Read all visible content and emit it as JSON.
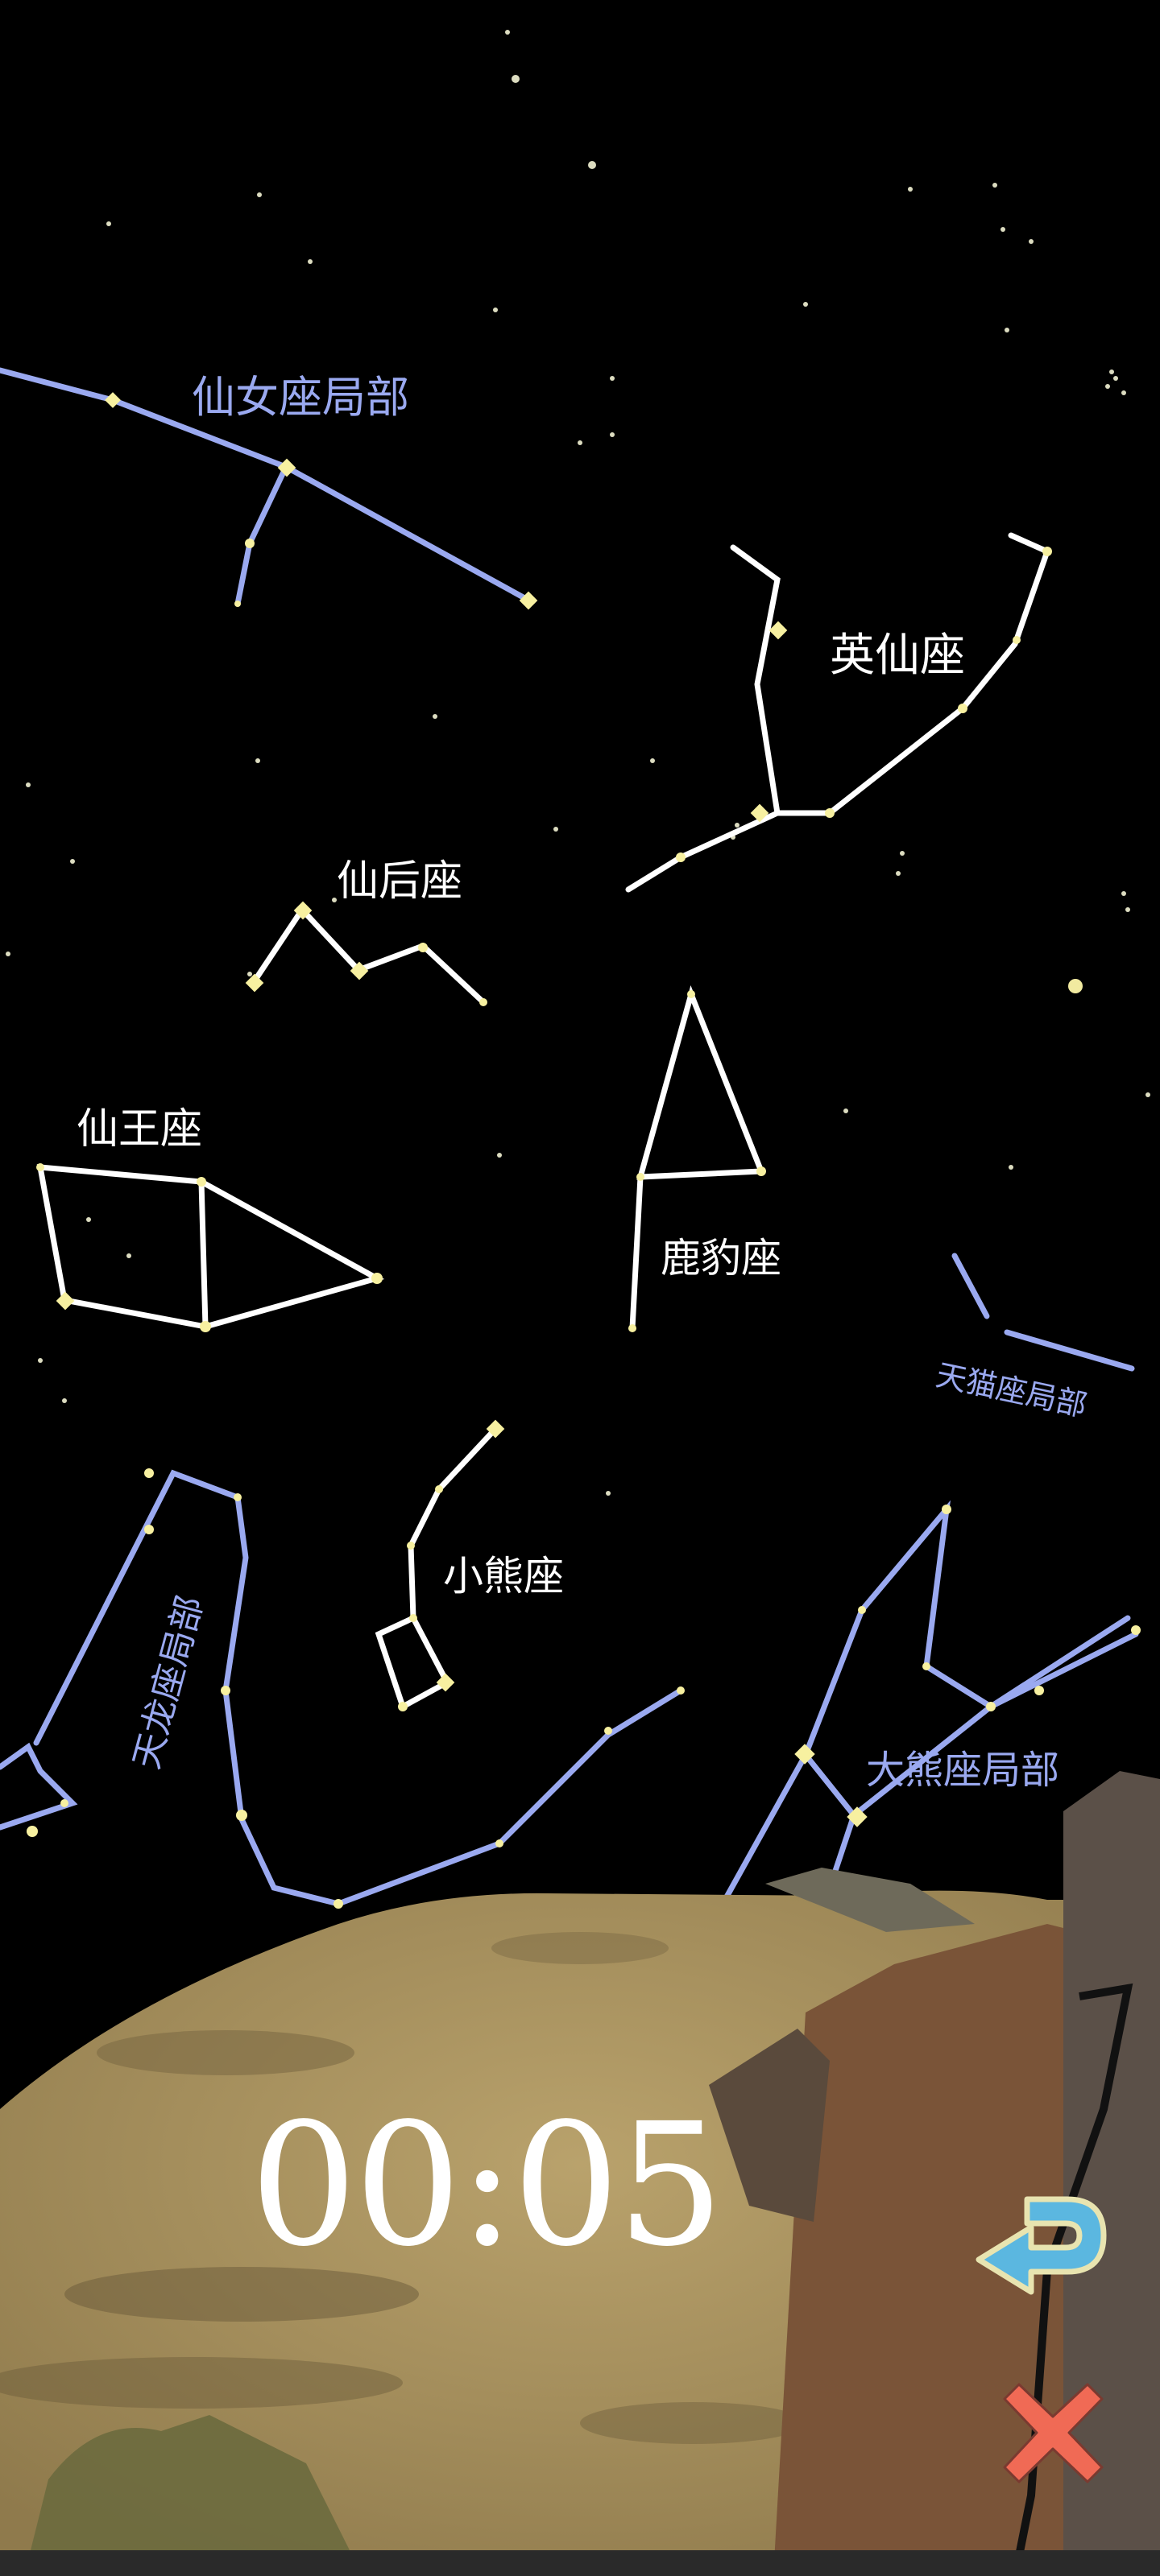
{
  "constellations": {
    "andromeda": "仙女座局部",
    "cepheus_hero": "英仙座",
    "cassiopeia": "仙后座",
    "cepheus": "仙王座",
    "camelopardalis": "鹿豹座",
    "lynx": "天猫座局部",
    "ursa_minor": "小熊座",
    "draco": "天龙座局部",
    "ursa_major": "大熊座局部"
  },
  "timer": {
    "value": "00:05"
  },
  "controls": {
    "undo_icon": "undo-arrow-icon",
    "close_icon": "close-x-icon"
  },
  "colors": {
    "sky": "#000000",
    "solved_line": "#ffffff",
    "hint_line": "#9aa9f0",
    "star": "#f7f0a0",
    "ground": "#a8915e",
    "cliff": "#7a5438",
    "undo": "#5bb7e0",
    "close": "#f06a55"
  }
}
